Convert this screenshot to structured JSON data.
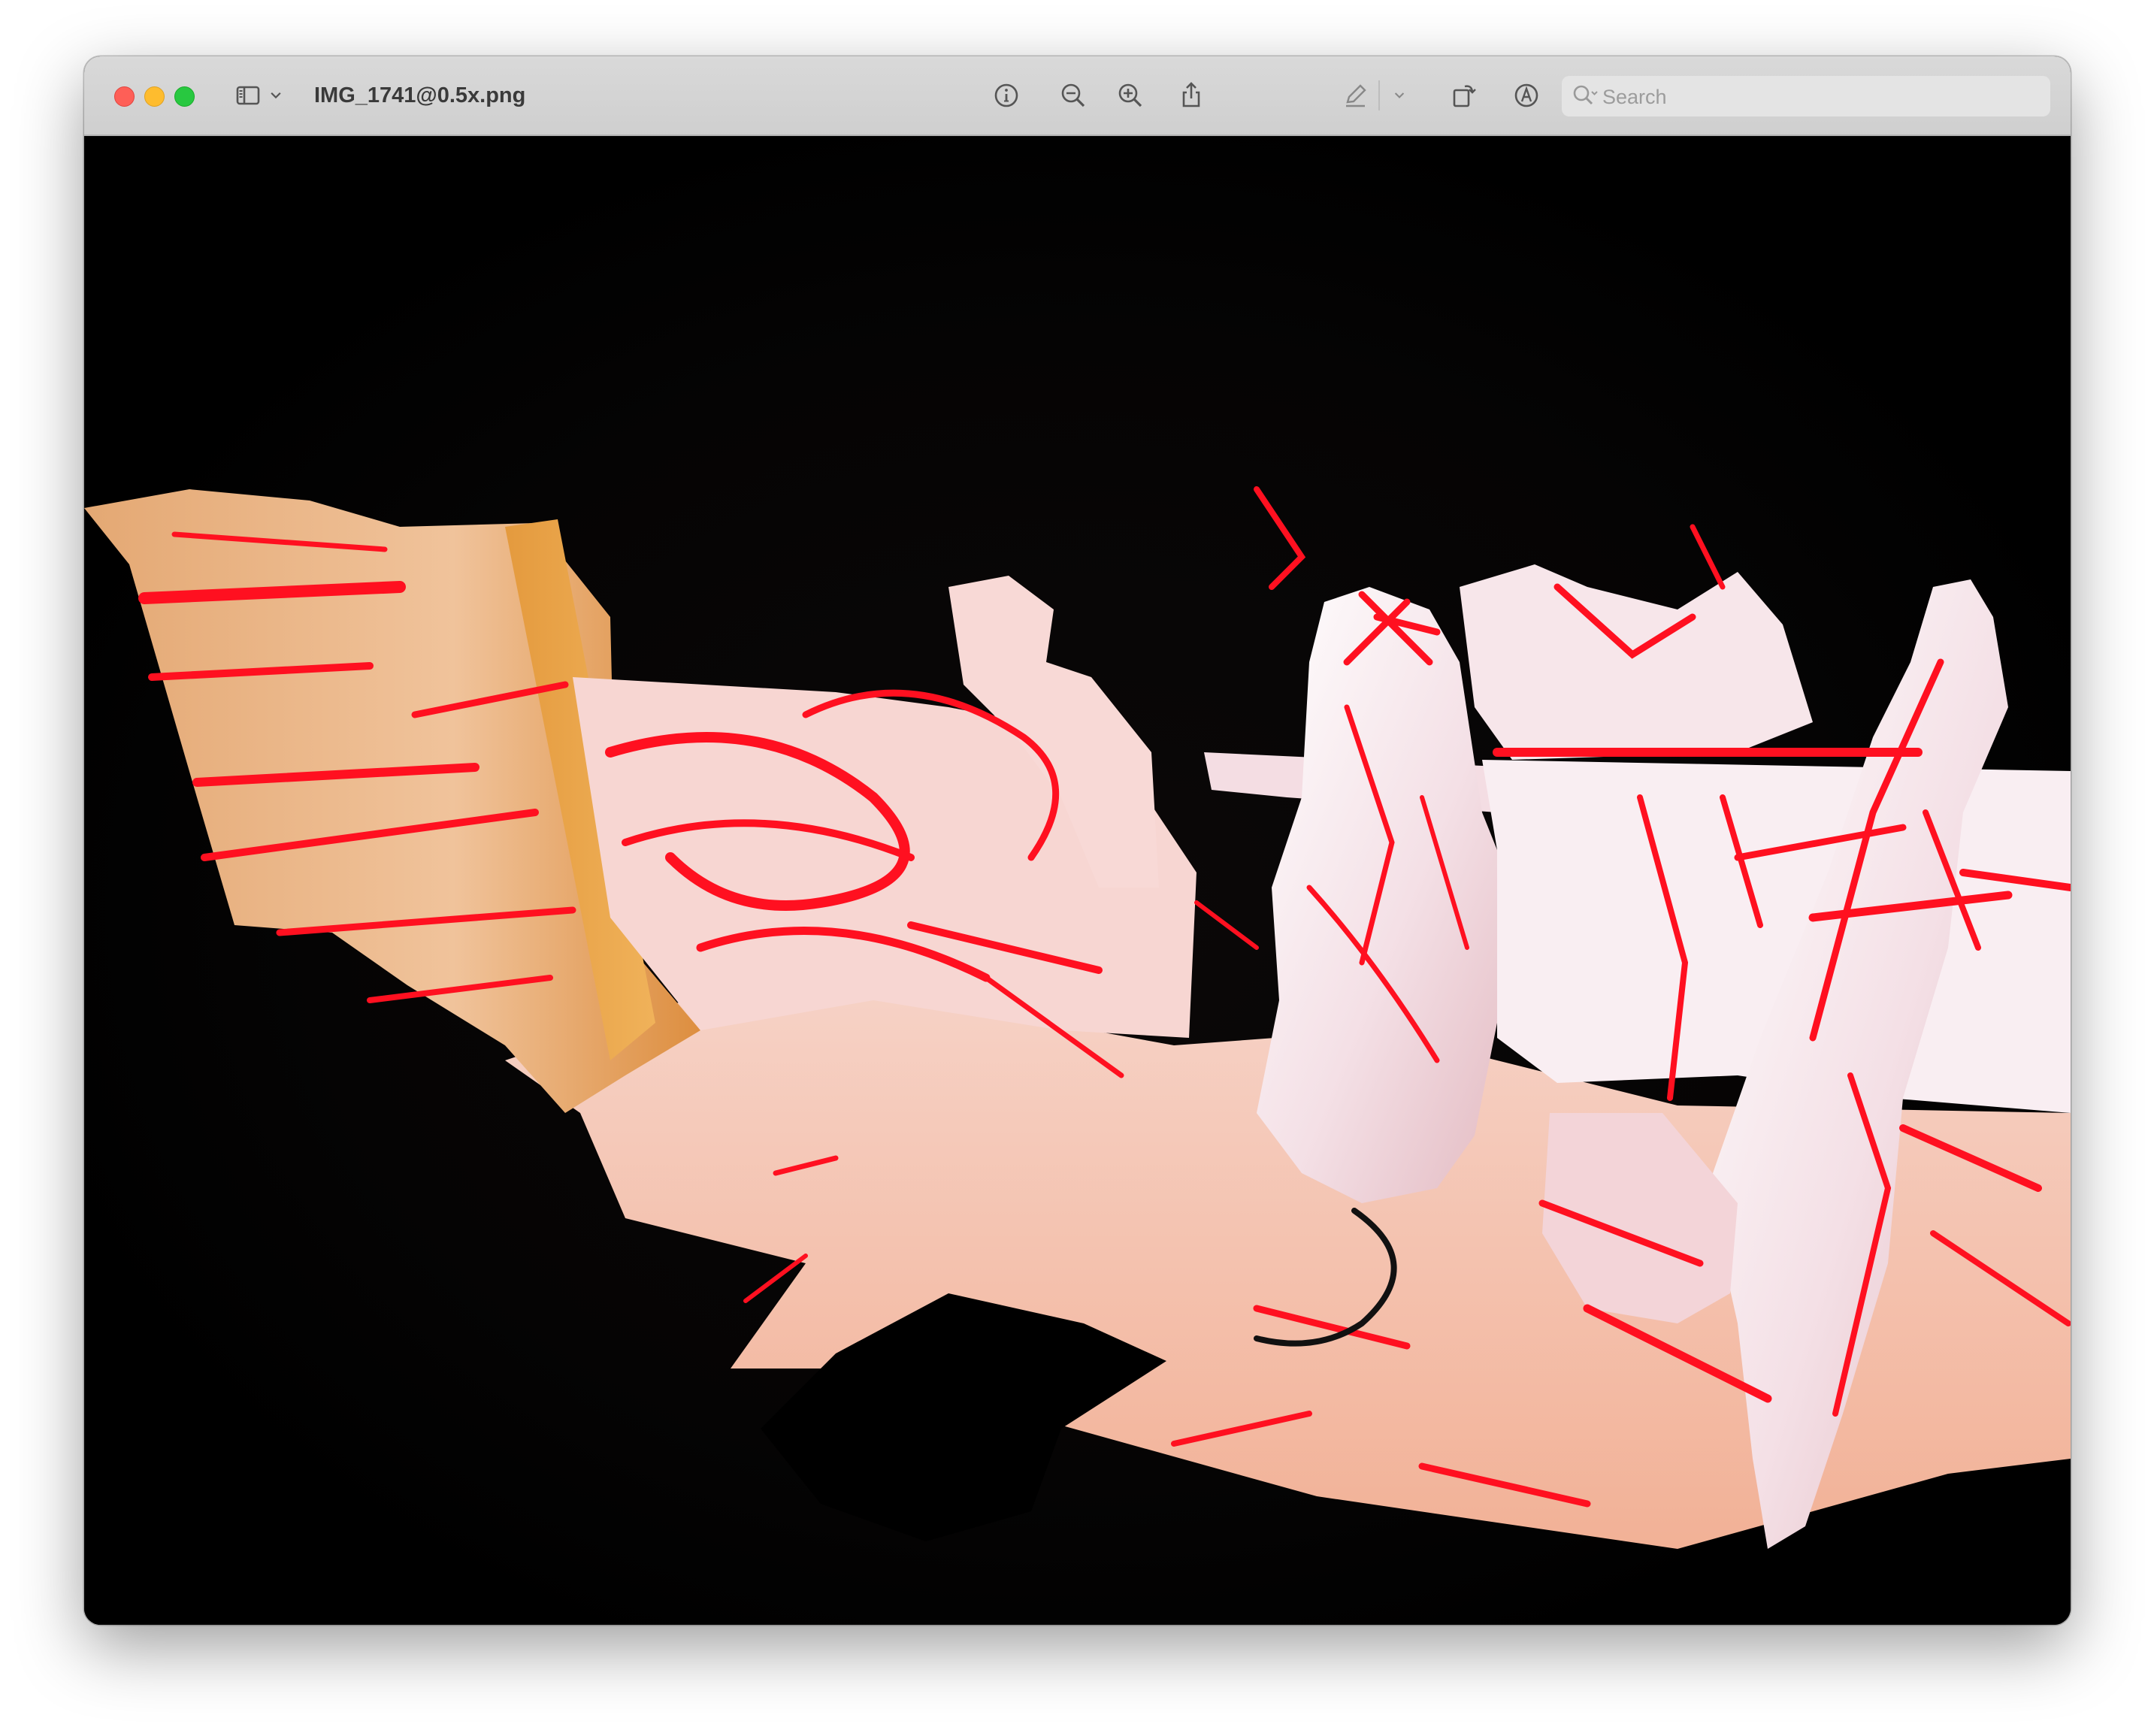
{
  "window": {
    "title": "IMG_1741@0.5x.png"
  },
  "toolbar": {
    "sidebar_toggle_icon": "sidebar-icon",
    "sidebar_menu_icon": "chevron-down-icon",
    "info_icon": "info-icon",
    "zoom_out_icon": "zoom-out-icon",
    "zoom_in_icon": "zoom-in-icon",
    "share_icon": "share-icon",
    "markup_icon": "pen-icon",
    "markup_menu_icon": "chevron-down-icon",
    "rotate_icon": "rotate-icon",
    "annotate_icon": "markup-circle-icon",
    "signature_icon": "signature-icon"
  },
  "search": {
    "placeholder": "Search"
  },
  "colors": {
    "titlebar": "#d3d3d3",
    "content_background": "#000000",
    "surface_pink": "#f6c6bd",
    "surface_orange": "#e89a4c",
    "stroke_red": "#ff1020",
    "close": "#fe5f57",
    "minimize": "#febc2e",
    "zoom": "#28c840"
  }
}
